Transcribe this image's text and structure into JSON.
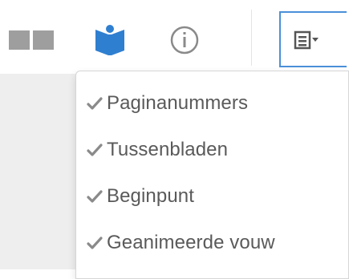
{
  "toolbar": {
    "buttons": [
      {
        "icon": "double-page-icon",
        "color": "#9e9e9e"
      },
      {
        "icon": "book-icon",
        "color": "#2f7fd1"
      },
      {
        "icon": "info-icon",
        "color": "#8a8a8a"
      },
      {
        "icon": "page-view-dropdown-icon",
        "color": "#555555"
      }
    ],
    "accent": "#4a90d9"
  },
  "menu": {
    "items": [
      {
        "label": "Paginanummers",
        "checked": true
      },
      {
        "label": "Tussenbladen",
        "checked": true
      },
      {
        "label": "Beginpunt",
        "checked": true
      },
      {
        "label": "Geanimeerde vouw",
        "checked": true
      }
    ],
    "check_color": "#8a8a8a"
  }
}
